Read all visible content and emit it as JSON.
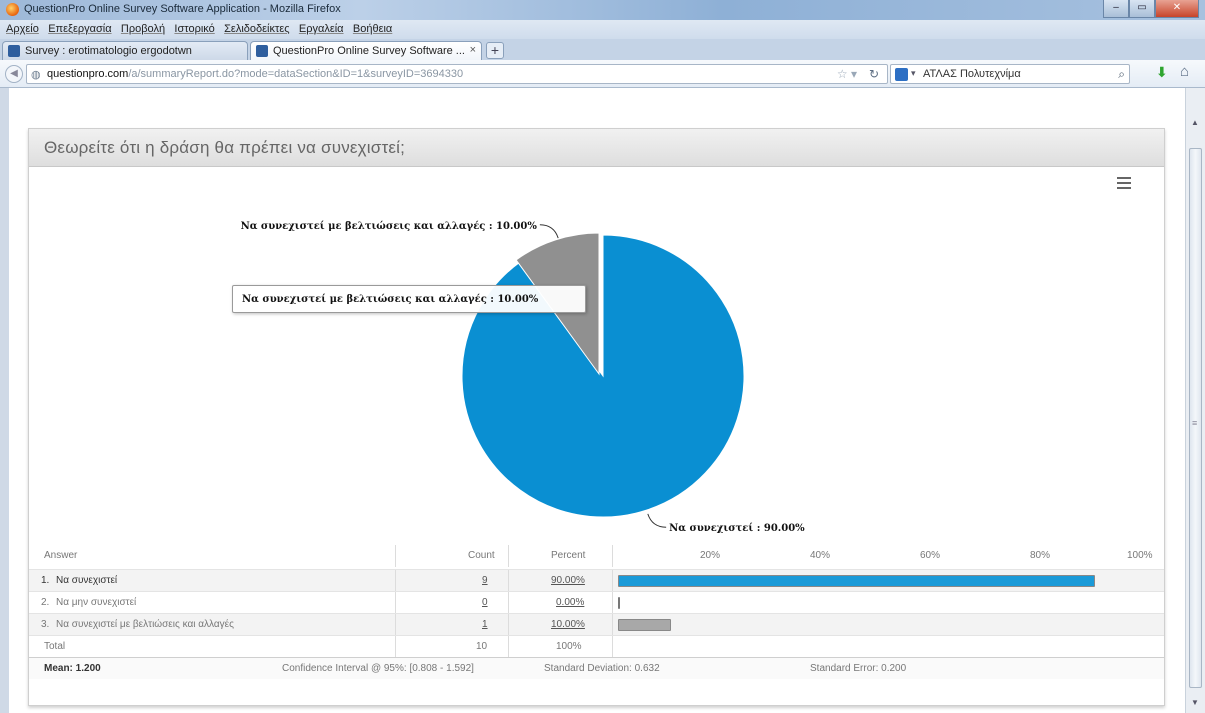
{
  "browser": {
    "window_title": "QuestionPro Online Survey Software Application - Mozilla Firefox",
    "menu": [
      "Αρχείο",
      "Επεξεργασία",
      "Προβολή",
      "Ιστορικό",
      "Σελιδοδείκτες",
      "Εργαλεία",
      "Βοήθεια"
    ],
    "tabs": [
      {
        "label": "Survey : erotimatologio ergodotwn",
        "active": false
      },
      {
        "label": "QuestionPro Online Survey Software ...",
        "active": true
      }
    ],
    "url_host": "questionpro.com",
    "url_path": "/a/summaryReport.do?mode=dataSection&ID=1&surveyID=3694330",
    "search_engine_label": "ΑΤΛΑΣ Πολυτεχνίμα"
  },
  "question": {
    "title": "Θεωρείτε ότι η δράση θα πρέπει να συνεχιστεί;"
  },
  "chart_data": {
    "type": "pie",
    "title": "",
    "slices": [
      {
        "label": "Να συνεχιστεί",
        "value": 90.0,
        "color": "#0a8fd2",
        "label_text": "Να συνεχιστεί : 90.00%"
      },
      {
        "label": "Να μην συνεχιστεί",
        "value": 0.0,
        "color": "#e8e8e8",
        "label_text": ""
      },
      {
        "label": "Να συνεχιστεί με βελτιώσεις και αλλαγές",
        "value": 10.0,
        "color": "#909090",
        "label_text": "Να συνεχιστεί με βελτιώσεις και αλλαγές : 10.00%"
      }
    ],
    "tooltip": "Να συνεχιστεί με βελτιώσεις και αλλαγές : 10.00%"
  },
  "table": {
    "headers": {
      "answer": "Answer",
      "count": "Count",
      "percent": "Percent"
    },
    "axis_ticks": [
      "20%",
      "40%",
      "60%",
      "80%",
      "100%"
    ],
    "rows": [
      {
        "rank": "1.",
        "answer": "Να συνεχιστεί",
        "count": "9",
        "percent": "90.00%",
        "fraction": 0.9,
        "color": "#1a9ad8",
        "bold": true
      },
      {
        "rank": "2.",
        "answer": "Να μην συνεχιστεί",
        "count": "0",
        "percent": "0.00%",
        "fraction": 0.0,
        "color": "#cfcfcf",
        "bold": false
      },
      {
        "rank": "3.",
        "answer": "Να συνεχιστεί με βελτιώσεις και αλλαγές",
        "count": "1",
        "percent": "10.00%",
        "fraction": 0.1,
        "color": "#a8a8a8",
        "bold": false
      }
    ],
    "total": {
      "label": "Total",
      "count": "10",
      "percent": "100%"
    },
    "stats": {
      "mean": "Mean: 1.200",
      "ci": "Confidence Interval @ 95%: [0.808 - 1.592]",
      "sd": "Standard Deviation: 0.632",
      "se": "Standard Error: 0.200"
    }
  }
}
